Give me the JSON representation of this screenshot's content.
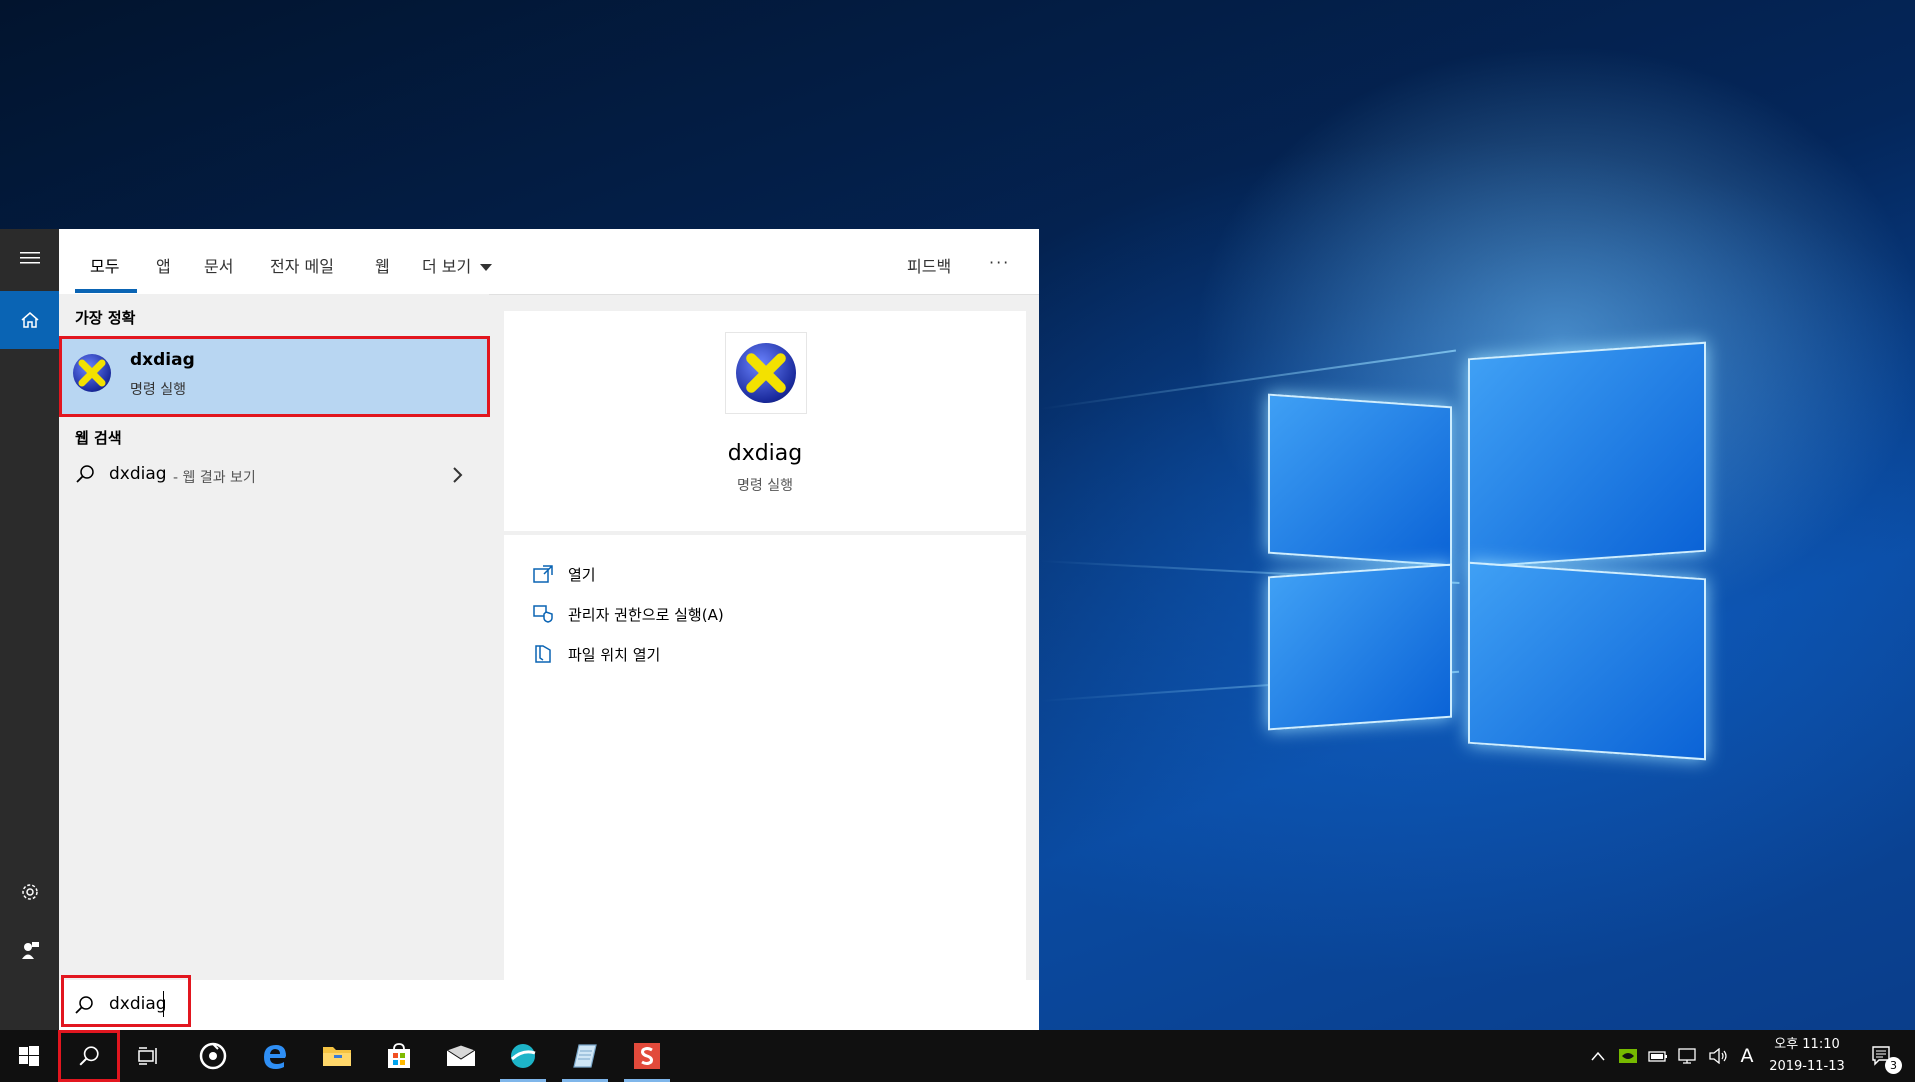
{
  "colors": {
    "accent": "#0a64b4",
    "highlight_outline": "#e2161f",
    "best_match_bg": "#b8d6f2"
  },
  "tabs": [
    {
      "label": "모두"
    },
    {
      "label": "앱"
    },
    {
      "label": "문서"
    },
    {
      "label": "전자 메일"
    },
    {
      "label": "웹"
    },
    {
      "label": "더 보기"
    }
  ],
  "feedback_label": "피드백",
  "more_options_label": "···",
  "best_match": {
    "section_title": "가장 정확",
    "name": "dxdiag",
    "subtitle": "명령 실행"
  },
  "web_search": {
    "section_title": "웹 검색",
    "query": "dxdiag",
    "suffix": "- 웹 결과 보기"
  },
  "detail": {
    "name": "dxdiag",
    "subtitle": "명령 실행",
    "actions": [
      {
        "label": "열기",
        "icon": "open-icon"
      },
      {
        "label": "관리자 권한으로 실행(A)",
        "icon": "shield-icon"
      },
      {
        "label": "파일 위치 열기",
        "icon": "file-location-icon"
      }
    ]
  },
  "search": {
    "value": "dxdiag"
  },
  "clock": {
    "time": "오후 11:10",
    "date": "2019-11-13"
  },
  "tray": {
    "input_indicator": "A",
    "notification_count": "3"
  }
}
